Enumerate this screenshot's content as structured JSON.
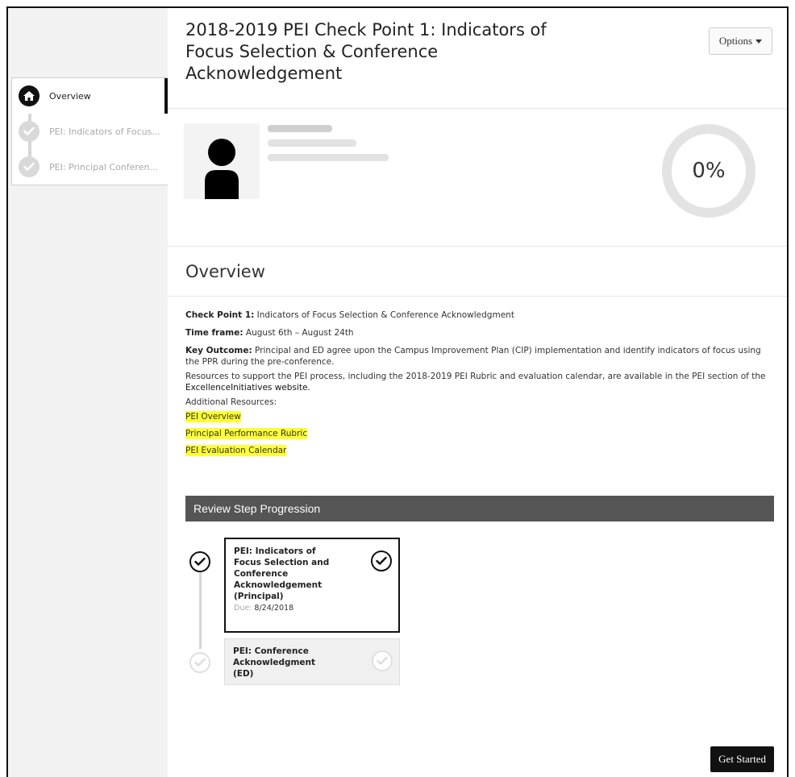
{
  "sidebar": {
    "items": [
      {
        "label": "Overview",
        "icon": "home-icon",
        "active": true
      },
      {
        "label": "PEI: Indicators of Focus...",
        "icon": "check-icon",
        "active": false
      },
      {
        "label": "PEI: Principal Conferen...",
        "icon": "check-icon",
        "active": false
      }
    ]
  },
  "header": {
    "title": "2018-2019 PEI Check Point 1: Indicators of Focus Selection & Conference Acknowledgement",
    "options_label": "Options"
  },
  "profile": {
    "progress_label": "0%",
    "progress": 0
  },
  "overview": {
    "heading": "Overview",
    "checkpoint_label": "Check Point 1:",
    "checkpoint_value": " Indicators of Focus Selection & Conference Acknowledgment",
    "timeframe_label": "Time frame:",
    "timeframe_value": "  August 6th – August 24th",
    "key_outcome_label": "Key Outcome:",
    "key_outcome_value": "  Principal and ED agree upon the Campus Improvement Plan (CIP) implementation and identify indicators of focus using the PPR during the pre-conference.",
    "resources_text": "Resources to support the PEI process, including the 2018-2019 PEI Rubric and evaluation calendar, are available in the PEI section of the ",
    "resources_link": "ExcellenceInitiatives website.",
    "additional_label": "Additional Resources:",
    "links": [
      "PEI Overview",
      "Principal Performance Rubric",
      "PEI Evaluation Calendar"
    ]
  },
  "review": {
    "heading": "Review Step Progression",
    "steps": [
      {
        "title": "PEI: Indicators of Focus Selection and Conference Acknowledgement (Principal)",
        "due_label": "Due:",
        "due": " 8/24/2018"
      },
      {
        "title": "PEI: Conference Acknowledgment (ED)"
      }
    ],
    "get_started_label": "Get Started"
  },
  "colors": {
    "highlight": "#ffff33",
    "bar": "#555555",
    "button": "#111111"
  }
}
